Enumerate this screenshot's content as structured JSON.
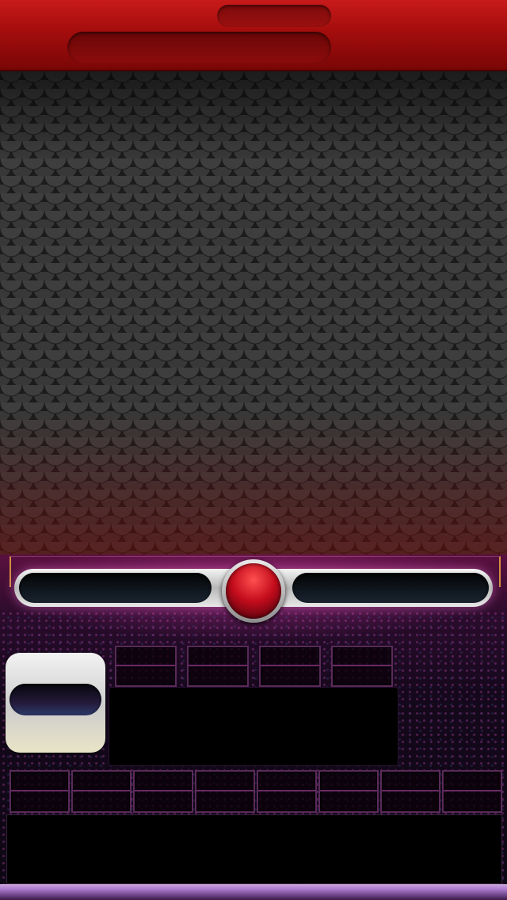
{
  "header": {
    "status_pill_text": "",
    "title_pill_text": ""
  },
  "slider": {
    "left_slot_text": "",
    "right_slot_text": "",
    "knob_color": "#c40c1c"
  },
  "dock": {
    "app_card_text": "",
    "center_panel_text": "",
    "bottom_panel_text": "",
    "top_tile_count": 4,
    "bottom_tile_count": 8
  },
  "colors": {
    "top_bar": "#a40d0d",
    "accent_pink": "#d23caa",
    "frame_gold": "#d49040"
  }
}
